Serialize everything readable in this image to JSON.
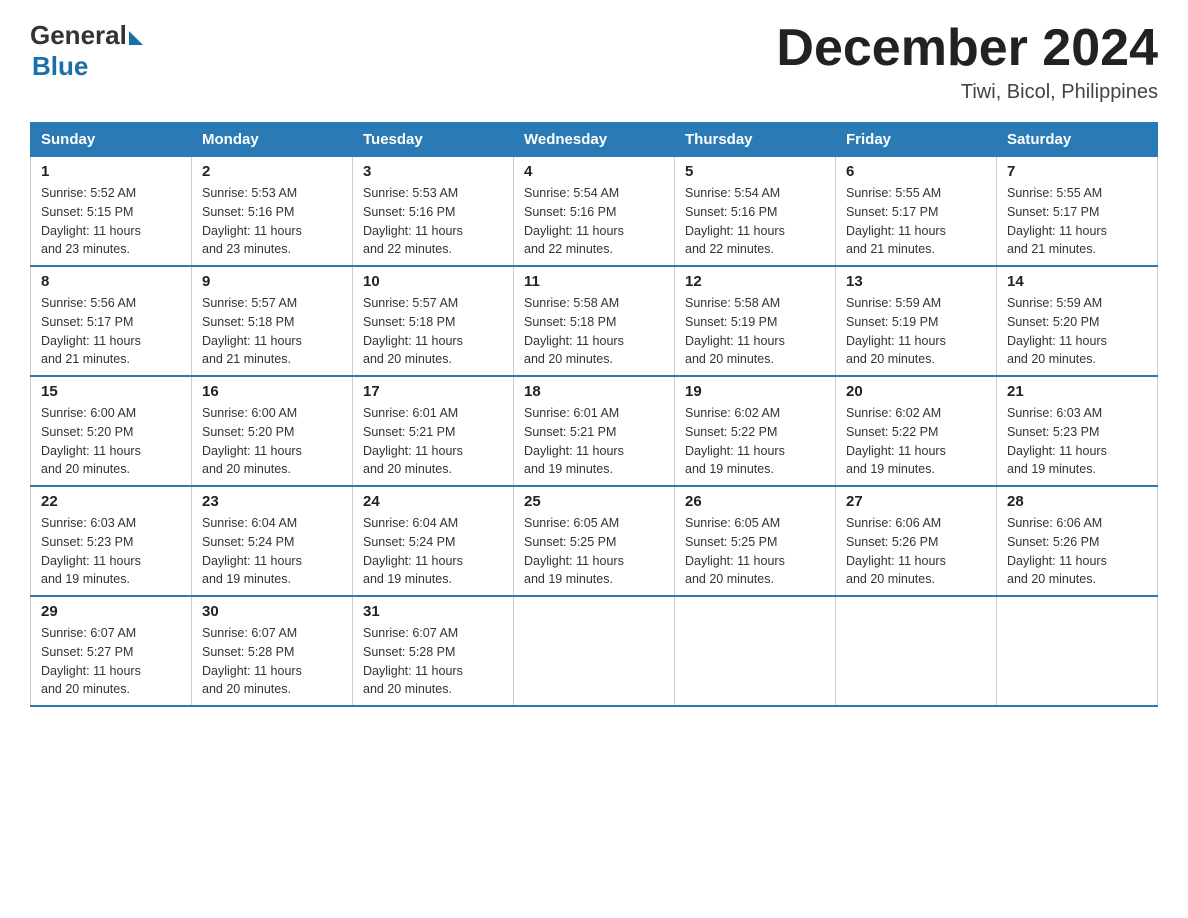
{
  "header": {
    "logo_general": "General",
    "logo_blue": "Blue",
    "month_year": "December 2024",
    "location": "Tiwi, Bicol, Philippines"
  },
  "days_of_week": [
    "Sunday",
    "Monday",
    "Tuesday",
    "Wednesday",
    "Thursday",
    "Friday",
    "Saturday"
  ],
  "weeks": [
    [
      {
        "day": "1",
        "sunrise": "5:52 AM",
        "sunset": "5:15 PM",
        "daylight": "11 hours and 23 minutes."
      },
      {
        "day": "2",
        "sunrise": "5:53 AM",
        "sunset": "5:16 PM",
        "daylight": "11 hours and 23 minutes."
      },
      {
        "day": "3",
        "sunrise": "5:53 AM",
        "sunset": "5:16 PM",
        "daylight": "11 hours and 22 minutes."
      },
      {
        "day": "4",
        "sunrise": "5:54 AM",
        "sunset": "5:16 PM",
        "daylight": "11 hours and 22 minutes."
      },
      {
        "day": "5",
        "sunrise": "5:54 AM",
        "sunset": "5:16 PM",
        "daylight": "11 hours and 22 minutes."
      },
      {
        "day": "6",
        "sunrise": "5:55 AM",
        "sunset": "5:17 PM",
        "daylight": "11 hours and 21 minutes."
      },
      {
        "day": "7",
        "sunrise": "5:55 AM",
        "sunset": "5:17 PM",
        "daylight": "11 hours and 21 minutes."
      }
    ],
    [
      {
        "day": "8",
        "sunrise": "5:56 AM",
        "sunset": "5:17 PM",
        "daylight": "11 hours and 21 minutes."
      },
      {
        "day": "9",
        "sunrise": "5:57 AM",
        "sunset": "5:18 PM",
        "daylight": "11 hours and 21 minutes."
      },
      {
        "day": "10",
        "sunrise": "5:57 AM",
        "sunset": "5:18 PM",
        "daylight": "11 hours and 20 minutes."
      },
      {
        "day": "11",
        "sunrise": "5:58 AM",
        "sunset": "5:18 PM",
        "daylight": "11 hours and 20 minutes."
      },
      {
        "day": "12",
        "sunrise": "5:58 AM",
        "sunset": "5:19 PM",
        "daylight": "11 hours and 20 minutes."
      },
      {
        "day": "13",
        "sunrise": "5:59 AM",
        "sunset": "5:19 PM",
        "daylight": "11 hours and 20 minutes."
      },
      {
        "day": "14",
        "sunrise": "5:59 AM",
        "sunset": "5:20 PM",
        "daylight": "11 hours and 20 minutes."
      }
    ],
    [
      {
        "day": "15",
        "sunrise": "6:00 AM",
        "sunset": "5:20 PM",
        "daylight": "11 hours and 20 minutes."
      },
      {
        "day": "16",
        "sunrise": "6:00 AM",
        "sunset": "5:20 PM",
        "daylight": "11 hours and 20 minutes."
      },
      {
        "day": "17",
        "sunrise": "6:01 AM",
        "sunset": "5:21 PM",
        "daylight": "11 hours and 20 minutes."
      },
      {
        "day": "18",
        "sunrise": "6:01 AM",
        "sunset": "5:21 PM",
        "daylight": "11 hours and 19 minutes."
      },
      {
        "day": "19",
        "sunrise": "6:02 AM",
        "sunset": "5:22 PM",
        "daylight": "11 hours and 19 minutes."
      },
      {
        "day": "20",
        "sunrise": "6:02 AM",
        "sunset": "5:22 PM",
        "daylight": "11 hours and 19 minutes."
      },
      {
        "day": "21",
        "sunrise": "6:03 AM",
        "sunset": "5:23 PM",
        "daylight": "11 hours and 19 minutes."
      }
    ],
    [
      {
        "day": "22",
        "sunrise": "6:03 AM",
        "sunset": "5:23 PM",
        "daylight": "11 hours and 19 minutes."
      },
      {
        "day": "23",
        "sunrise": "6:04 AM",
        "sunset": "5:24 PM",
        "daylight": "11 hours and 19 minutes."
      },
      {
        "day": "24",
        "sunrise": "6:04 AM",
        "sunset": "5:24 PM",
        "daylight": "11 hours and 19 minutes."
      },
      {
        "day": "25",
        "sunrise": "6:05 AM",
        "sunset": "5:25 PM",
        "daylight": "11 hours and 19 minutes."
      },
      {
        "day": "26",
        "sunrise": "6:05 AM",
        "sunset": "5:25 PM",
        "daylight": "11 hours and 20 minutes."
      },
      {
        "day": "27",
        "sunrise": "6:06 AM",
        "sunset": "5:26 PM",
        "daylight": "11 hours and 20 minutes."
      },
      {
        "day": "28",
        "sunrise": "6:06 AM",
        "sunset": "5:26 PM",
        "daylight": "11 hours and 20 minutes."
      }
    ],
    [
      {
        "day": "29",
        "sunrise": "6:07 AM",
        "sunset": "5:27 PM",
        "daylight": "11 hours and 20 minutes."
      },
      {
        "day": "30",
        "sunrise": "6:07 AM",
        "sunset": "5:28 PM",
        "daylight": "11 hours and 20 minutes."
      },
      {
        "day": "31",
        "sunrise": "6:07 AM",
        "sunset": "5:28 PM",
        "daylight": "11 hours and 20 minutes."
      },
      null,
      null,
      null,
      null
    ]
  ],
  "labels": {
    "sunrise": "Sunrise:",
    "sunset": "Sunset:",
    "daylight": "Daylight:"
  }
}
